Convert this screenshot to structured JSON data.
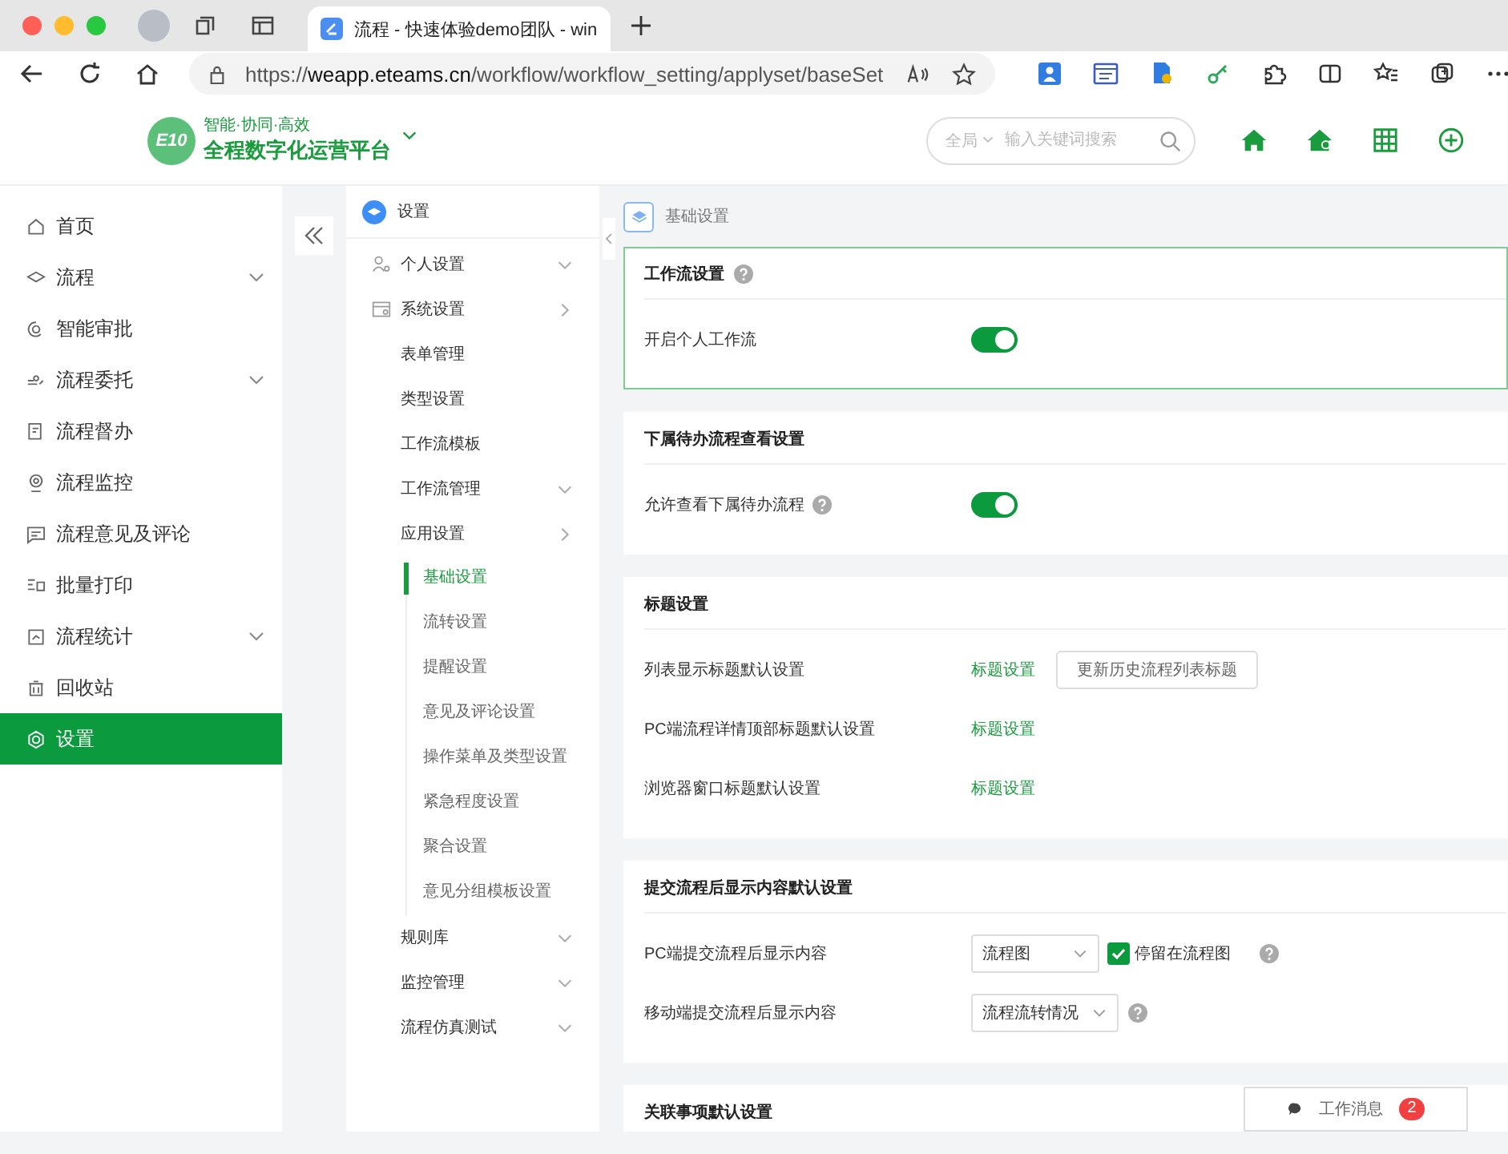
{
  "browser": {
    "tab_title": "流程 - 快速体验demo团队 - win",
    "url_prefix": "https://",
    "url_host": "weapp.eteams.cn",
    "url_path": "/workflow/workflow_setting/applyset/baseSet"
  },
  "header": {
    "logo_mark": "E10",
    "slogan": "智能·协同·高效",
    "platform_name": "全程数字化运营平台",
    "search": {
      "scope": "全局",
      "placeholder": "输入关键词搜索"
    }
  },
  "nav": {
    "items": [
      {
        "label": "首页",
        "expandable": false,
        "selected": false
      },
      {
        "label": "流程",
        "expandable": true,
        "selected": false
      },
      {
        "label": "智能审批",
        "expandable": false,
        "selected": false
      },
      {
        "label": "流程委托",
        "expandable": true,
        "selected": false
      },
      {
        "label": "流程督办",
        "expandable": false,
        "selected": false
      },
      {
        "label": "流程监控",
        "expandable": false,
        "selected": false
      },
      {
        "label": "流程意见及评论",
        "expandable": false,
        "selected": false
      },
      {
        "label": "批量打印",
        "expandable": false,
        "selected": false
      },
      {
        "label": "流程统计",
        "expandable": true,
        "selected": false
      },
      {
        "label": "回收站",
        "expandable": false,
        "selected": false
      },
      {
        "label": "设置",
        "expandable": false,
        "selected": true
      }
    ]
  },
  "submenu": {
    "title": "设置",
    "items": [
      {
        "label": "个人设置",
        "expanded": false
      },
      {
        "label": "系统设置",
        "expanded": true,
        "children": [
          {
            "label": "表单管理"
          },
          {
            "label": "类型设置"
          },
          {
            "label": "工作流模板"
          },
          {
            "label": "工作流管理",
            "expanded": false
          },
          {
            "label": "应用设置",
            "expanded": true,
            "children": [
              {
                "label": "基础设置",
                "selected": true
              },
              {
                "label": "流转设置",
                "selected": false
              },
              {
                "label": "提醒设置",
                "selected": false
              },
              {
                "label": "意见及评论设置",
                "selected": false
              },
              {
                "label": "操作菜单及类型设置",
                "selected": false
              },
              {
                "label": "紧急程度设置",
                "selected": false
              },
              {
                "label": "聚合设置",
                "selected": false
              },
              {
                "label": "意见分组模板设置",
                "selected": false
              }
            ]
          },
          {
            "label": "规则库",
            "expanded": false
          },
          {
            "label": "监控管理",
            "expanded": false
          },
          {
            "label": "流程仿真测试",
            "expanded": false
          }
        ]
      }
    ]
  },
  "main": {
    "breadcrumb": "基础设置",
    "sections": [
      {
        "title": "工作流设置",
        "help": true,
        "focused": true,
        "rows": [
          {
            "kind": "toggle",
            "label": "开启个人工作流",
            "help": false,
            "on": true
          }
        ]
      },
      {
        "title": "下属待办流程查看设置",
        "help": false,
        "focused": false,
        "rows": [
          {
            "kind": "toggle",
            "label": "允许查看下属待办流程",
            "help": true,
            "on": true
          }
        ]
      },
      {
        "title": "标题设置",
        "help": false,
        "focused": false,
        "rows": [
          {
            "kind": "link",
            "label": "列表显示标题默认设置",
            "help": false,
            "link": "标题设置",
            "button": "更新历史流程列表标题"
          },
          {
            "kind": "link",
            "label": "PC端流程详情顶部标题默认设置",
            "help": false,
            "link": "标题设置"
          },
          {
            "kind": "link",
            "label": "浏览器窗口标题默认设置",
            "help": false,
            "link": "标题设置"
          }
        ]
      },
      {
        "title": "提交流程后显示内容默认设置",
        "help": false,
        "focused": false,
        "rows": [
          {
            "kind": "select",
            "label": "PC端提交流程后显示内容",
            "help": true,
            "value": "流程图",
            "checkbox": {
              "label": "停留在流程图",
              "checked": true
            }
          },
          {
            "kind": "select",
            "label": "移动端提交流程后显示内容",
            "help": true,
            "value": "流程流转情况"
          }
        ]
      },
      {
        "title": "关联事项默认设置",
        "help": false,
        "focused": false
      }
    ]
  },
  "messages": {
    "label": "工作消息",
    "count": "2"
  }
}
